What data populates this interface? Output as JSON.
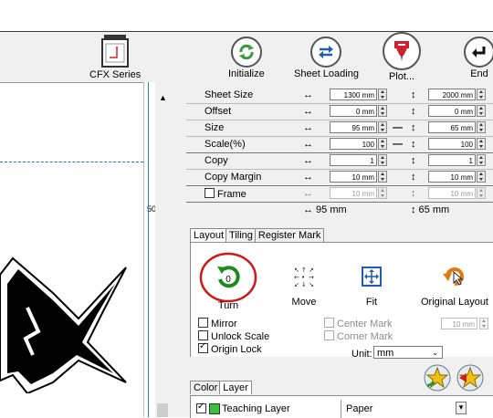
{
  "toolbar": {
    "cfx_label": "CFX Series",
    "initialize_label": "Initialize",
    "sheet_loading_label": "Sheet Loading",
    "plot_label": "Plot...",
    "end_label": "End"
  },
  "ruler": {
    "label": "50"
  },
  "properties": {
    "sheet_size": {
      "label": "Sheet Size",
      "w": "1300 mm",
      "h": "2000 mm"
    },
    "offset": {
      "label": "Offset",
      "w": "0 mm",
      "h": "0 mm"
    },
    "size": {
      "label": "Size",
      "w": "95 mm",
      "h": "65 mm"
    },
    "scale": {
      "label": "Scale(%)",
      "w": "100",
      "h": "100"
    },
    "copy": {
      "label": "Copy",
      "w": "1",
      "h": "1"
    },
    "copy_margin": {
      "label": "Copy Margin",
      "w": "10 mm",
      "h": "10 mm"
    },
    "frame": {
      "label": "Frame",
      "w": "10 mm",
      "h": "10 mm"
    },
    "summary_w": "↔ 95 mm",
    "summary_h": "↕ 65 mm"
  },
  "tabs": {
    "layout": "Layout",
    "tiling": "Tiling",
    "register_mark": "Register Mark"
  },
  "layout": {
    "turn_label": "Turn",
    "turn_value": "0",
    "move_label": "Move",
    "fit_label": "Fit",
    "original_label": "Original Layout",
    "mirror": "Mirror",
    "unlock_scale": "Unlock Scale",
    "origin_lock": "Origin Lock",
    "center_mark": "Center Mark",
    "corner_mark": "Corner Mark",
    "mark_value": "10 mm",
    "unit_label": "Unit:",
    "unit_value": "mm"
  },
  "tabs2": {
    "color": "Color",
    "layer": "Layer"
  },
  "layer": {
    "name": "Teaching Layer",
    "material": "Paper"
  },
  "colors": {
    "accent_green": "#3a9a3a",
    "accent_blue": "#1e5fb4",
    "plot_red": "#d02030",
    "highlight_red": "#d01818"
  }
}
